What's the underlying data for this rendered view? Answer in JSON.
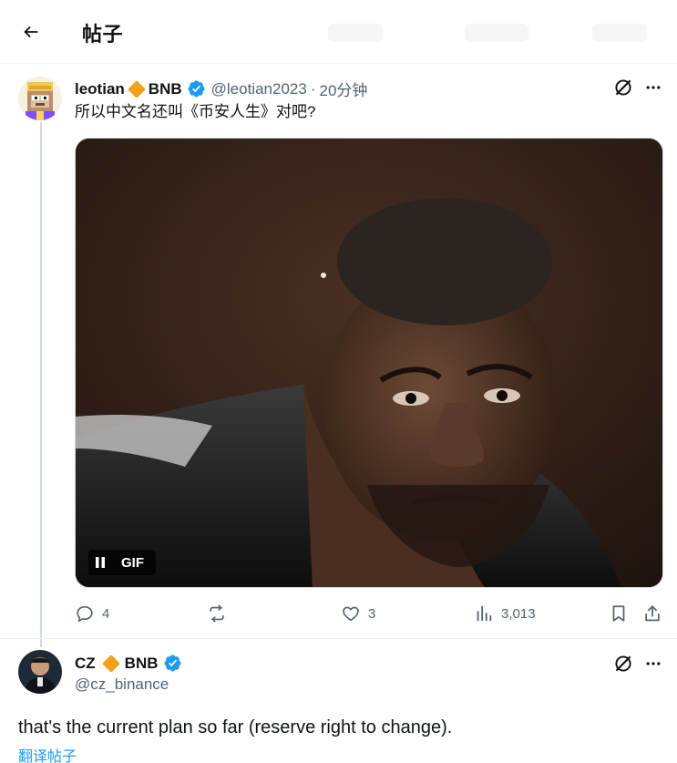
{
  "header": {
    "title": "帖子",
    "back_icon": "arrow-left-icon"
  },
  "tweet": {
    "display_name": "leotian",
    "name_suffix": "BNB",
    "handle": "@leotian2023",
    "separator": "·",
    "time": "20分钟",
    "text": "所以中文名还叫《币安人生》对吧?",
    "media": {
      "type": "GIF",
      "gif_label": "GIF",
      "pause_icon": "pause-icon"
    },
    "stats": {
      "replies": "4",
      "reposts": "",
      "likes": "3",
      "views": "3,013"
    }
  },
  "reply": {
    "display_name": "CZ",
    "name_suffix": "BNB",
    "handle": "@cz_binance",
    "text": "that's the current plan so far (reserve right to change).",
    "translate": "翻译帖子"
  },
  "colors": {
    "accent": "#1d9bf0",
    "verified": "#1d9bf0",
    "diamond": "#f3a11b",
    "muted": "#536471"
  }
}
